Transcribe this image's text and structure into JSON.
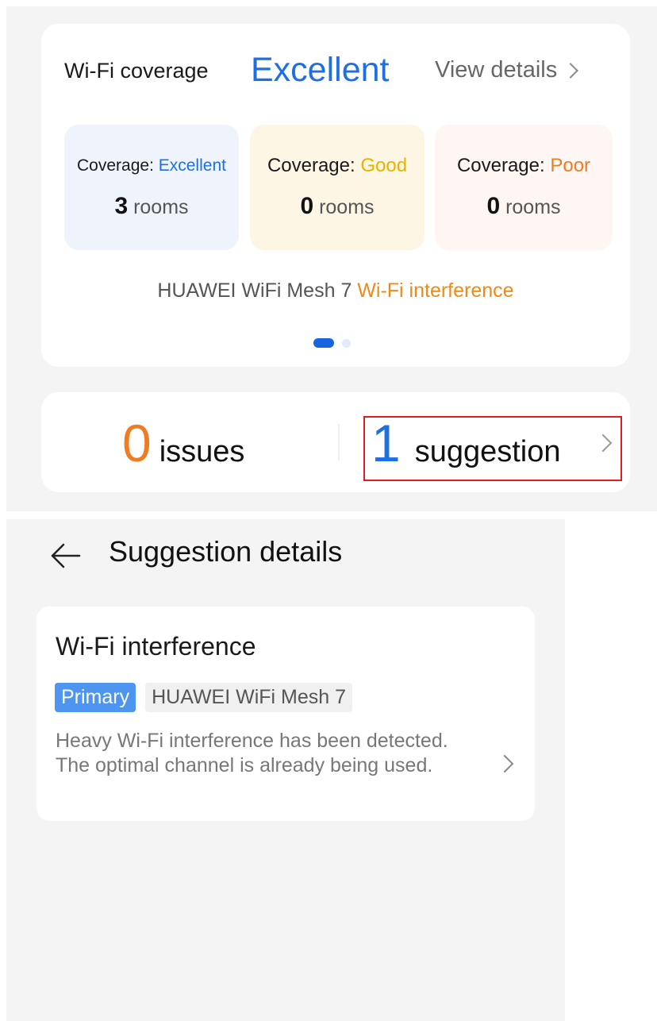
{
  "coverage": {
    "title": "Wi-Fi coverage",
    "status": "Excellent",
    "view_details": "View details",
    "boxes": [
      {
        "label": "Coverage: ",
        "value": "Excellent",
        "value_color": "#1f6fe4",
        "count": "3",
        "unit": "rooms"
      },
      {
        "label": "Coverage: ",
        "value": "Good",
        "value_color": "#e8b400",
        "count": "0",
        "unit": "rooms"
      },
      {
        "label": "Coverage: ",
        "value": "Poor",
        "value_color": "#ef7b22",
        "count": "0",
        "unit": "rooms"
      }
    ],
    "device_name": "HUAWEI WiFi Mesh 7",
    "device_warning": "Wi-Fi interference",
    "page_indicator": {
      "current": 1,
      "total": 2
    }
  },
  "summary": {
    "issues_count": "0",
    "issues_label": "issues",
    "suggestion_count": "1",
    "suggestion_label": "suggestion"
  },
  "details_page": {
    "title": "Suggestion details",
    "card": {
      "title": "Wi-Fi interference",
      "tag_primary": "Primary",
      "tag_device": "HUAWEI WiFi Mesh 7",
      "description": "Heavy Wi-Fi interference has been detected. The optimal channel is already being used."
    }
  },
  "colors": {
    "accent_blue": "#1f6fe4",
    "warning_orange": "#ef7b22",
    "highlight_red": "#e11b22"
  },
  "icons": [
    "chevron-right-icon",
    "back-arrow-icon"
  ]
}
